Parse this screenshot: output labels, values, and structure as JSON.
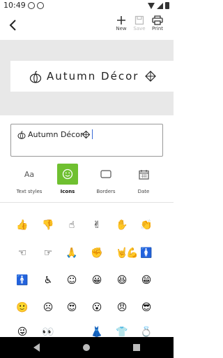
{
  "status_bar": {
    "time": "10:49"
  },
  "toolbar": {
    "new_label": "New",
    "save_label": "Save",
    "print_label": "Print"
  },
  "preview": {
    "label_text": "Autumn Décor"
  },
  "editor": {
    "value": "Autumn Décor"
  },
  "tabs": [
    {
      "label": "Text styles",
      "active": false
    },
    {
      "label": "Icons",
      "active": true
    },
    {
      "label": "Borders",
      "active": false
    },
    {
      "label": "Date",
      "active": false
    }
  ],
  "colors": {
    "accent": "#6fc030",
    "preview_bg": "#e8e8e8",
    "nav_bg": "#000000"
  },
  "icons": [
    [
      "thumbs-up-icon",
      "thumbs-down-icon",
      "pointing-up-icon",
      "victory-hand-icon",
      "waving-hand-icon",
      "clapping-hands-icon"
    ],
    [
      "pointing-left-icon",
      "pointing-right-icon",
      "folded-hands-icon",
      "raised-fist-icon",
      "rock-on-hand-icon",
      "flexed-arm-icon",
      "woman-icon"
    ],
    [
      "man-icon",
      "wheelchair-icon",
      "smiley-icon",
      "grinning-face-icon",
      "laughing-face-icon",
      "big-grin-face-icon"
    ],
    [
      "slight-smile-icon",
      "frowning-face-icon",
      "heart-eyes-face-icon",
      "surprised-face-icon",
      "angry-face-icon",
      "sunglasses-face-icon"
    ],
    [
      "crazy-face-icon",
      "eyes-icon",
      "dress-icon",
      "tshirt-icon",
      "ring-icon"
    ]
  ]
}
